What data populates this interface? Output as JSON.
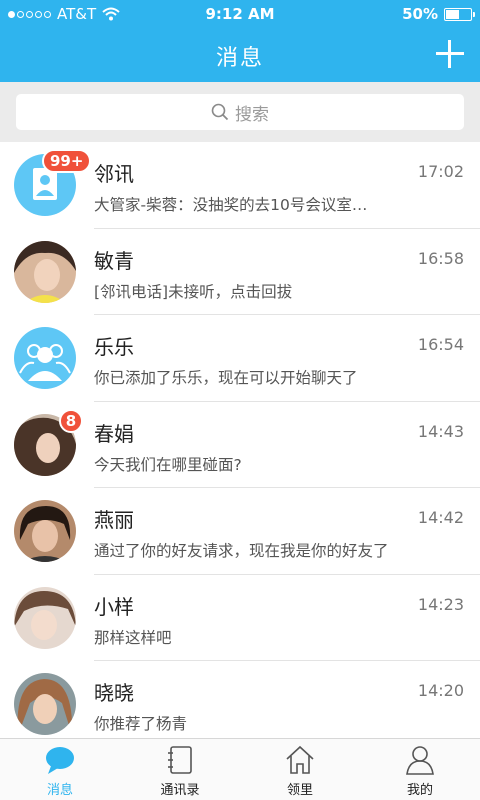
{
  "status_bar": {
    "carrier": "AT&T",
    "time": "9:12 AM",
    "battery": "50%",
    "battery_level": 0.5
  },
  "nav": {
    "title": "消息"
  },
  "search": {
    "placeholder": "搜索"
  },
  "conversations": [
    {
      "name": "邻讯",
      "time": "17:02",
      "message": "大管家-柴蓉：没抽奖的去10号会议室…",
      "badge": "99+"
    },
    {
      "name": "敏青",
      "time": "16:58",
      "message": "[邻讯电话]未接听，点击回拔",
      "badge": ""
    },
    {
      "name": "乐乐",
      "time": "16:54",
      "message": "你已添加了乐乐，现在可以开始聊天了",
      "badge": ""
    },
    {
      "name": "春娟",
      "time": "14:43",
      "message": "今天我们在哪里碰面?",
      "badge": "8"
    },
    {
      "name": "燕丽",
      "time": "14:42",
      "message": "通过了你的好友请求，现在我是你的好友了",
      "badge": ""
    },
    {
      "name": "小样",
      "time": "14:23",
      "message": "那样这样吧",
      "badge": ""
    },
    {
      "name": "晓晓",
      "time": "14:20",
      "message": "你推荐了杨青",
      "badge": ""
    }
  ],
  "tabs": [
    {
      "label": "消息",
      "icon": "chat-bubble-icon",
      "active": true
    },
    {
      "label": "通讯录",
      "icon": "contacts-book-icon",
      "active": false
    },
    {
      "label": "领里",
      "icon": "home-icon",
      "active": false
    },
    {
      "label": "我的",
      "icon": "person-icon",
      "active": false
    }
  ],
  "colors": {
    "accent": "#2fb4ee",
    "badge": "#f0513a"
  }
}
